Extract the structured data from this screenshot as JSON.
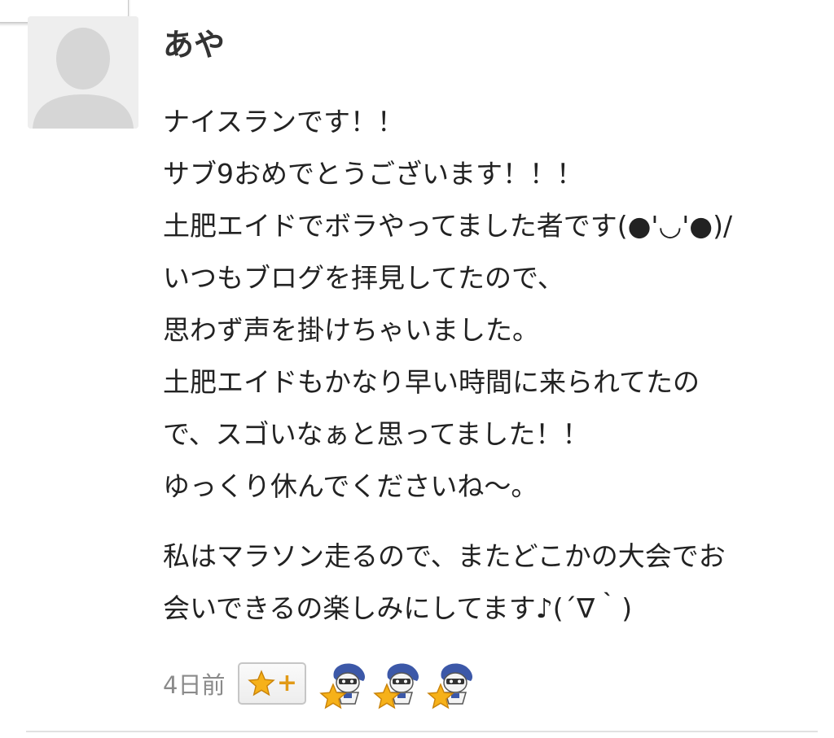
{
  "comment": {
    "author": "あや",
    "lines": [
      "ナイスランです！！",
      "サブ9おめでとうございます！！！",
      "土肥エイドでボラやってました者です(●'◡'●)/",
      "いつもブログを拝見してたので、",
      "思わず声を掛けちゃいました。",
      "土肥エイドもかなり早い時間に来られてたの",
      "で、スゴいなぁと思ってました！！",
      "ゆっくり休んでくださいね〜。"
    ],
    "lines2": [
      "私はマラソン走るので、またどこかの大会でお",
      "会いできるの楽しみにしてます♪(´∇｀)"
    ],
    "timestamp": "4日前",
    "star_button_plus": "+"
  },
  "colors": {
    "star": "#f6b119",
    "star_outline": "#c9830a",
    "character_blue": "#3c58a8",
    "divider": "#e1e1e1"
  }
}
